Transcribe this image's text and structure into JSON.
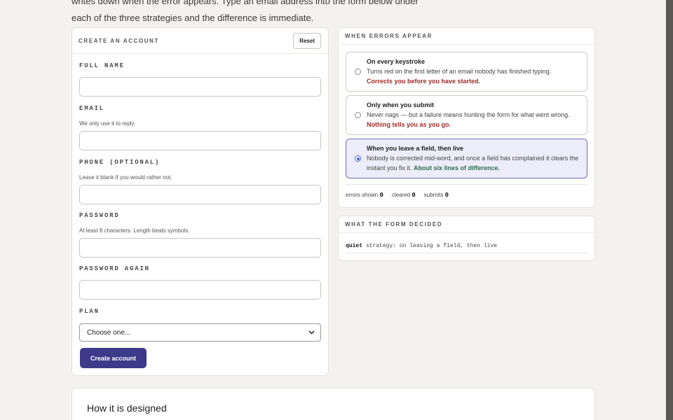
{
  "intro": {
    "line1": "writes down when the error appears. Type an email address into the form below under",
    "line2": "each of the three strategies and the difference is immediate."
  },
  "form": {
    "title": "CREATE AN ACCOUNT",
    "reset_label": "Reset",
    "fields": [
      {
        "label": "FULL NAME",
        "help": "",
        "value": ""
      },
      {
        "label": "EMAIL",
        "help": "We only use it to reply.",
        "value": ""
      },
      {
        "label": "PHONE (OPTIONAL)",
        "help": "Leave it blank if you would rather not.",
        "value": ""
      },
      {
        "label": "PASSWORD",
        "help": "At least 8 characters. Length beats symbols.",
        "value": ""
      },
      {
        "label": "PASSWORD AGAIN",
        "help": "",
        "value": ""
      }
    ],
    "plan": {
      "label": "PLAN",
      "selected": "Choose one..."
    },
    "submit_label": "Create account"
  },
  "strategies": {
    "title": "WHEN ERRORS APPEAR",
    "options": [
      {
        "title": "On every keystroke",
        "desc": "Turns red on the first letter of an email nobody has finished typing.",
        "verdict": "Corrects you before you have started.",
        "selected": false
      },
      {
        "title": "Only when you submit",
        "desc": "Never nags — but a failure means hunting the form for what went wrong.",
        "verdict": "Nothing tells you as you go.",
        "selected": false
      },
      {
        "title": "When you leave a field, then live",
        "desc": "Nobody is corrected mid-word, and once a field has complained it clears the instant you fix it.",
        "verdict": "About six lines of difference.",
        "selected": true
      }
    ],
    "counters": {
      "errors_label": "errors shown",
      "errors_value": "0",
      "cleared_label": "cleared",
      "cleared_value": "0",
      "submits_label": "submits",
      "submits_value": "0"
    },
    "colors": {
      "selected_bg": "#ececfa",
      "verdict_red": "#a12a2a",
      "verdict_green": "#2f6d4d",
      "accent": "#3d3a8a"
    }
  },
  "decided": {
    "title": "WHAT THE FORM DECIDED",
    "keyword": "quiet",
    "text": "strategy: on leaving a field, then live"
  },
  "design": {
    "title": "How it is designed"
  }
}
